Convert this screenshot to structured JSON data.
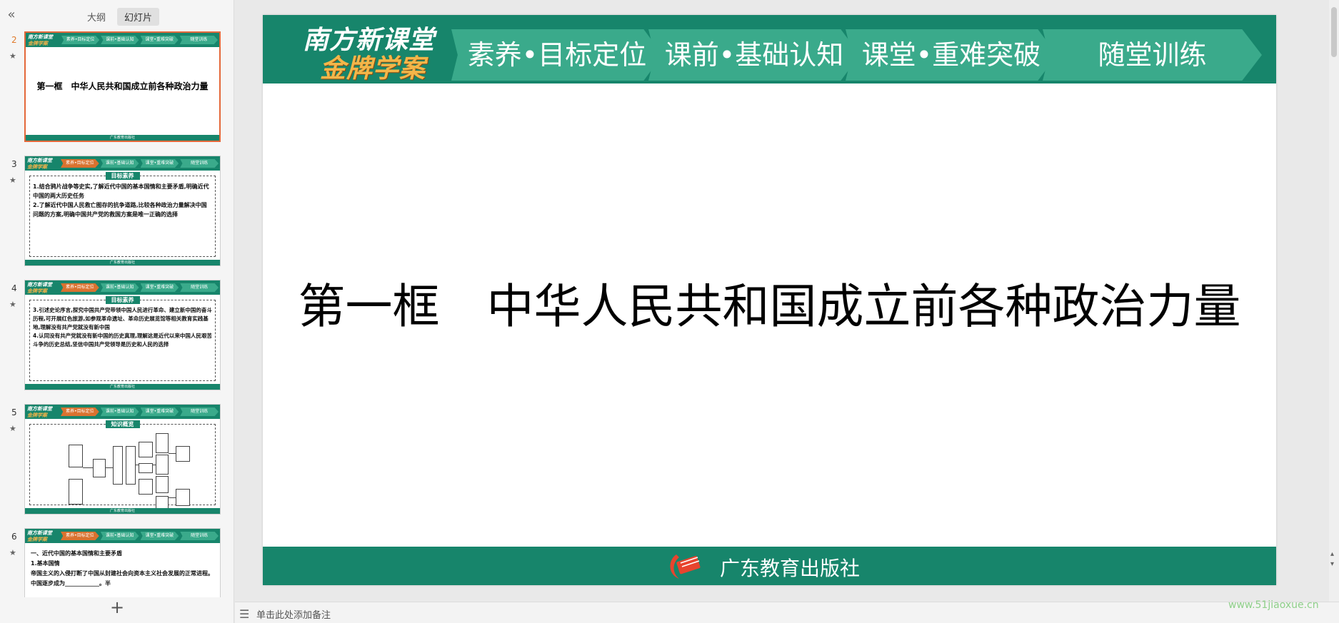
{
  "left_panel": {
    "tabs": [
      "大纲",
      "幻灯片"
    ],
    "active_tab": "幻灯片",
    "collapse_icon": "double-chevron-left-icon",
    "add_icon": "plus-icon"
  },
  "thumbnails": [
    {
      "num": "2",
      "nav": [
        "素养•目标定位",
        "课前•基础认知",
        "课堂•重难突破",
        "随堂训练"
      ],
      "title": "第一框　中华人民共和国成立前各种政治力量",
      "footer": "广东教育出版社"
    },
    {
      "num": "3",
      "nav": [
        "素养•目标定位",
        "课前•基础认知",
        "课堂•重难突破",
        "随堂训练"
      ],
      "box_label": "目标素养",
      "text": "1.结合鸦片战争等史实,了解近代中国的基本国情和主要矛盾,明确近代中国的两大历史任务\n2.了解近代中国人民救亡图存的抗争道路,比较各种政治力量解决中国问题的方案,明确中国共产党的救国方案是唯一正确的选择",
      "footer": "广东教育出版社"
    },
    {
      "num": "4",
      "nav": [
        "素养•目标定位",
        "课前•基础认知",
        "课堂•重难突破",
        "随堂训练"
      ],
      "box_label": "目标素养",
      "text": "3.引述史论序言,探究中国共产党带领中国人民进行革命、建立新中国的奋斗历程,可开展红色旅游,如参观革命遗址、革命历史展览馆等相关教育实践基地,理解没有共产党就没有新中国\n4.认同没有共产党就没有新中国的历史真理,理解这是近代以来中国人民艰苦斗争的历史总结,坚信中国共产党领导是历史和人民的选择",
      "footer": "广东教育出版社"
    },
    {
      "num": "5",
      "nav": [
        "素养•目标定位",
        "课前•基础认知",
        "课堂•重难突破",
        "随堂训练"
      ],
      "box_label": "知识概览",
      "footer": "广东教育出版社"
    },
    {
      "num": "6",
      "nav": [
        "素养•目标定位",
        "课前•基础认知",
        "课堂•重难突破",
        "随堂训练"
      ],
      "text": "一、近代中国的基本国情和主要矛盾\n1.基本国情\n帝国主义的入侵打断了中国从封建社会向资本主义社会发展的正常进程。中国逐步成为____________。半",
      "footer": "广东教育出版社"
    }
  ],
  "slide": {
    "logo_line1": "南方新课堂",
    "logo_line2": "金牌学案",
    "nav": [
      "素养•目标定位",
      "课前•基础认知",
      "课堂•重难突破",
      "随堂训练"
    ],
    "title": "第一框　中华人民共和国成立前各种政治力量",
    "footer": "广东教育出版社"
  },
  "notes": {
    "placeholder": "单击此处添加备注"
  },
  "watermark": "www.51jiaoxue.cn",
  "colors": {
    "header_green": "#17856b",
    "nav_green": "#3aaa8b",
    "active_orange": "#d9722f",
    "selected_border": "#e4683a",
    "logo_gold": "#f3b649"
  }
}
